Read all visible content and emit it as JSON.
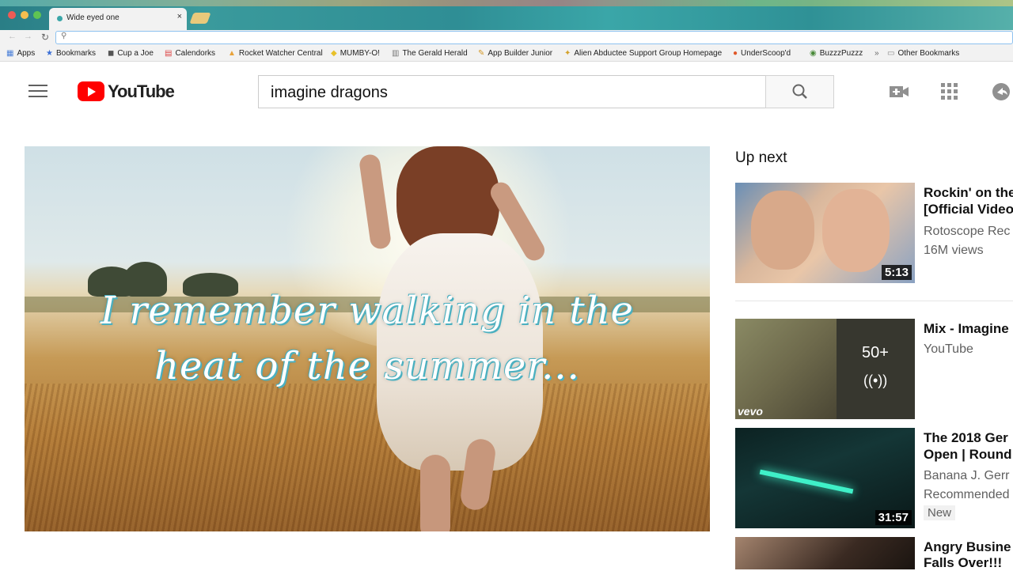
{
  "browser": {
    "tab_title": "Wide eyed one",
    "tab_close": "×",
    "bookmarks": [
      "Apps",
      "Bookmarks",
      "Cup a Joe",
      "Calendorks",
      "Rocket Watcher Central",
      "MUMBY-O!",
      "The Gerald Herald",
      "App Builder Junior",
      "Alien Abductee Support Group Homepage",
      "UnderScoop'd",
      "BuzzzPuzzz"
    ],
    "overflow": "»",
    "other_bookmarks": "Other Bookmarks"
  },
  "header": {
    "logo_text": "YouTube",
    "search_value": "imagine dragons"
  },
  "player": {
    "lyric_line1": "I remember walking in the",
    "lyric_line2": "heat of the summer..."
  },
  "up_next": {
    "title": "Up next",
    "items": [
      {
        "title1": "Rockin' on the",
        "title2": "[Official Video",
        "channel": "Rotoscope Rec",
        "views": "16M views",
        "duration": "5:13"
      },
      {
        "title1": "Mix - Imagine",
        "channel": "YouTube",
        "count": "50+",
        "vevo": "vevo"
      },
      {
        "title1": "The 2018 Ger",
        "title2": "Open | Round",
        "channel": "Banana J. Gerr",
        "extra": "Recommended",
        "badge": "New",
        "duration": "31:57"
      },
      {
        "title1": "Angry Busine",
        "title2": "Falls Over!!!"
      }
    ]
  }
}
